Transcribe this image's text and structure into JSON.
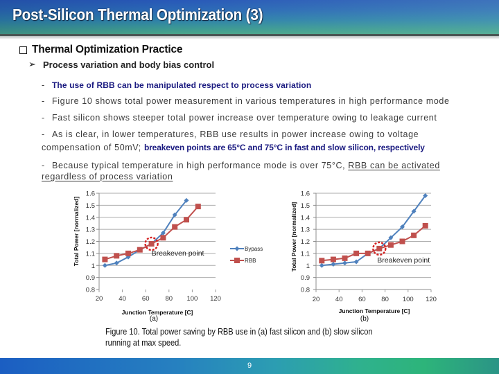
{
  "header": {
    "title": "Post-Silicon Thermal Optimization (3)"
  },
  "section": {
    "bullet_icon": "hollow-square",
    "heading": "Thermal Optimization Practice"
  },
  "subsection": {
    "bullet_icon": "arrow-bullet",
    "arrow_glyph": "➢",
    "heading": "Process variation and body bias control"
  },
  "bullets": [
    {
      "dash": "-",
      "text": "The use of RBB can be manipulated respect to process variation"
    },
    {
      "dash": "-",
      "text": "Figure 10 shows total power measurement in various temperatures in high performance mode"
    },
    {
      "dash": "-",
      "text": "Fast silicon shows steeper total power increase over temperature owing to leakage current"
    },
    {
      "dash": "-",
      "text_line1": "As is clear, in lower temperatures, RBB use results in power increase owing to voltage",
      "text_line2": "compensation of 50mV; ",
      "emphasis": "breakeven points are 65°C and 75°C in fast and slow silicon, respectively"
    },
    {
      "dash": "-",
      "text": "Because typical temperature in high performance mode is over 75°C, ",
      "underlined_line1": "RBB can be activated",
      "underlined_line2": "regardless of process variation"
    }
  ],
  "figure": {
    "caption_line1": "Figure 10. Total power saving by RBB use in (a) fast silicon and (b) slow silicon",
    "caption_line2": "running at max speed."
  },
  "colors": {
    "emphasis_text": "#1a1a80",
    "bypass": "#4f81bd",
    "rbb": "#c0504d",
    "breakeven_marker": "#d42020"
  },
  "chart_data": [
    {
      "type": "line",
      "title": "",
      "sublabel": "(a)",
      "xlabel": "Junction Temperature [C]",
      "ylabel": "Total Power [normalized]",
      "xlim": [
        20,
        120
      ],
      "ylim": [
        0.8,
        1.6
      ],
      "xticks": [
        20,
        40,
        60,
        80,
        100,
        120
      ],
      "xtick_labels": [
        "20",
        "40",
        "60",
        "80",
        "100",
        "120"
      ],
      "yticks": [
        0.8,
        0.9,
        1.0,
        1.1,
        1.2,
        1.3,
        1.4,
        1.5,
        1.6
      ],
      "ytick_labels": [
        "0.8",
        "0.9",
        "1",
        "1.1",
        "1.2",
        "1.3",
        "1.4",
        "1.5",
        "1.6"
      ],
      "grid": "horizontal",
      "series": [
        {
          "name": "Bypass",
          "color": "#4f81bd",
          "marker": "diamond",
          "x": [
            25,
            35,
            45,
            55,
            65,
            75,
            85,
            95
          ],
          "y": [
            1.0,
            1.02,
            1.07,
            1.13,
            1.18,
            1.27,
            1.42,
            1.54
          ]
        },
        {
          "name": "RBB",
          "color": "#c0504d",
          "marker": "square",
          "x": [
            25,
            35,
            45,
            55,
            65,
            75,
            85,
            95,
            105
          ],
          "y": [
            1.05,
            1.08,
            1.1,
            1.13,
            1.18,
            1.23,
            1.32,
            1.38,
            1.49
          ]
        }
      ],
      "annotation": {
        "text": "Breakeven point",
        "x": 65,
        "y": 1.18
      },
      "legend": {
        "position": "right",
        "entries": [
          "Bypass",
          "RBB"
        ]
      }
    },
    {
      "type": "line",
      "title": "",
      "sublabel": "(b)",
      "xlabel": "Junction Temperature [C]",
      "ylabel": "Total Power [normalized]",
      "xlim": [
        20,
        120
      ],
      "ylim": [
        0.8,
        1.6
      ],
      "xticks": [
        20,
        40,
        60,
        80,
        100,
        120
      ],
      "xtick_labels": [
        "20",
        "40",
        "60",
        "80",
        "100",
        "120"
      ],
      "yticks": [
        0.8,
        0.9,
        1.0,
        1.1,
        1.2,
        1.3,
        1.4,
        1.5,
        1.6
      ],
      "ytick_labels": [
        "0.8",
        "0.9",
        "1",
        "1.1",
        "1.2",
        "1.3",
        "1.4",
        "1.5",
        "1.6"
      ],
      "grid": "horizontal",
      "series": [
        {
          "name": "Bypass",
          "color": "#4f81bd",
          "marker": "diamond",
          "x": [
            25,
            35,
            45,
            55,
            65,
            75,
            85,
            95,
            105,
            115
          ],
          "y": [
            1.0,
            1.01,
            1.02,
            1.03,
            1.1,
            1.14,
            1.23,
            1.32,
            1.45,
            1.58
          ]
        },
        {
          "name": "RBB",
          "color": "#c0504d",
          "marker": "square",
          "x": [
            25,
            35,
            45,
            55,
            65,
            75,
            85,
            95,
            105,
            115
          ],
          "y": [
            1.04,
            1.05,
            1.06,
            1.1,
            1.1,
            1.14,
            1.17,
            1.2,
            1.25,
            1.33
          ]
        }
      ],
      "annotation": {
        "text": "Breakeven point",
        "x": 75,
        "y": 1.14
      }
    }
  ],
  "footer": {
    "page_number": "9"
  }
}
